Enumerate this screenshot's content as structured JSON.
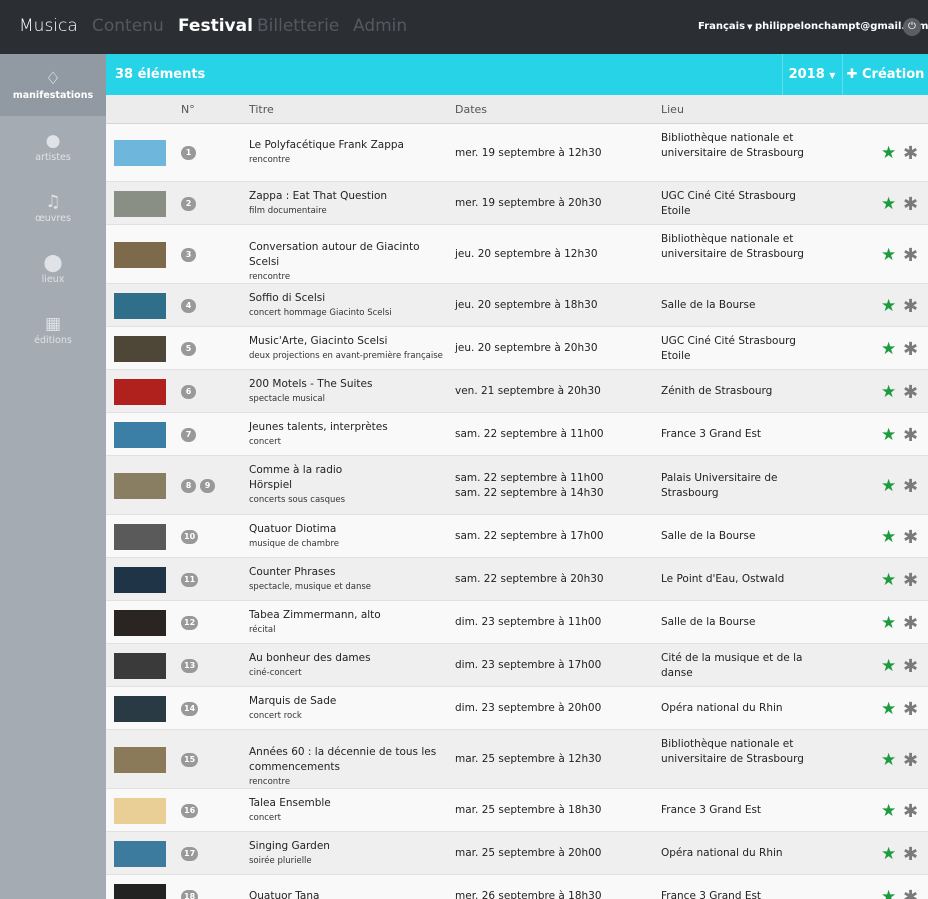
{
  "topbar": {
    "brand": "Musica",
    "nav": [
      "Contenu",
      "Festival",
      "Billetterie",
      "Admin"
    ],
    "language": "Français",
    "user": "philippelonchampt@gmail.com"
  },
  "sidebar": [
    {
      "label": "manifestations",
      "icon": "diamond-icon"
    },
    {
      "label": "artistes",
      "icon": "user-icon"
    },
    {
      "label": "œuvres",
      "icon": "music-icon"
    },
    {
      "label": "lieux",
      "icon": "map-marker-icon"
    },
    {
      "label": "éditions",
      "icon": "calendar-icon"
    }
  ],
  "toolbar": {
    "count": "38 éléments",
    "year": "2018",
    "create": "Création"
  },
  "columns": [
    "N°",
    "Titre",
    "Dates",
    "Lieu"
  ],
  "colors": {
    "accent": "#27d3e6",
    "topbar": "#2b2e33",
    "sidebar": "#a4abb3",
    "star": "#1e9b3f"
  },
  "rows": [
    {
      "nums": [
        "1"
      ],
      "title": "Le Polyfacétique Frank Zappa",
      "sub": "rencontre",
      "dates": [
        "mer. 19 septembre à 12h30"
      ],
      "lieu": "Bibliothèque nationale et universitaire de Strasbourg",
      "thumb": "#6fb6dc"
    },
    {
      "nums": [
        "2"
      ],
      "title": "Zappa : Eat That Question",
      "sub": "film documentaire",
      "dates": [
        "mer. 19 septembre à 20h30"
      ],
      "lieu": "UGC Ciné Cité Strasbourg Etoile",
      "thumb": "#8a8f86"
    },
    {
      "nums": [
        "3"
      ],
      "title": "Conversation autour de Giacinto Scelsi",
      "sub": "rencontre",
      "dates": [
        "jeu. 20 septembre à 12h30"
      ],
      "lieu": "Bibliothèque nationale et universitaire de Strasbourg",
      "thumb": "#7c6a4a"
    },
    {
      "nums": [
        "4"
      ],
      "title": "Soffio di Scelsi",
      "sub": "concert hommage Giacinto Scelsi",
      "dates": [
        "jeu. 20 septembre à 18h30"
      ],
      "lieu": "Salle de la Bourse",
      "thumb": "#2f6f8a"
    },
    {
      "nums": [
        "5"
      ],
      "title": "Music'Arte, Giacinto Scelsi",
      "sub": "deux projections en avant-première française",
      "dates": [
        "jeu. 20 septembre à 20h30"
      ],
      "lieu": "UGC Ciné Cité Strasbourg Etoile",
      "thumb": "#4e4636"
    },
    {
      "nums": [
        "6"
      ],
      "title": "200 Motels - The Suites",
      "sub": "spectacle musical",
      "dates": [
        "ven. 21 septembre à 20h30"
      ],
      "lieu": "Zénith de Strasbourg",
      "thumb": "#b0201c"
    },
    {
      "nums": [
        "7"
      ],
      "title": "Jeunes talents, interprètes",
      "sub": "concert",
      "dates": [
        "sam. 22 septembre à 11h00"
      ],
      "lieu": "France 3 Grand Est",
      "thumb": "#3b7ea6"
    },
    {
      "nums": [
        "8",
        "9"
      ],
      "title": "Comme à la radio\nHörspiel",
      "sub": "concerts sous casques",
      "dates": [
        "sam. 22 septembre à 11h00",
        "sam. 22 septembre à 14h30"
      ],
      "lieu": "Palais Universitaire de Strasbourg",
      "thumb": "#8a7e62"
    },
    {
      "nums": [
        "10"
      ],
      "title": "Quatuor Diotima",
      "sub": "musique de chambre",
      "dates": [
        "sam. 22 septembre à 17h00"
      ],
      "lieu": "Salle de la Bourse",
      "thumb": "#5a5a5a"
    },
    {
      "nums": [
        "11"
      ],
      "title": "Counter Phrases",
      "sub": "spectacle, musique et danse",
      "dates": [
        "sam. 22 septembre à 20h30"
      ],
      "lieu": "Le Point d'Eau, Ostwald",
      "thumb": "#1f3447"
    },
    {
      "nums": [
        "12"
      ],
      "title": "Tabea Zimmermann, alto",
      "sub": "récital",
      "dates": [
        "dim. 23 septembre à 11h00"
      ],
      "lieu": "Salle de la Bourse",
      "thumb": "#2a2522"
    },
    {
      "nums": [
        "13"
      ],
      "title": "Au bonheur des dames",
      "sub": "ciné-concert",
      "dates": [
        "dim. 23 septembre à 17h00"
      ],
      "lieu": "Cité de la musique et de la danse",
      "thumb": "#3a3a3a"
    },
    {
      "nums": [
        "14"
      ],
      "title": "Marquis de Sade",
      "sub": "concert rock",
      "dates": [
        "dim. 23 septembre à 20h00"
      ],
      "lieu": "Opéra national du Rhin",
      "thumb": "#2a3a44"
    },
    {
      "nums": [
        "15"
      ],
      "title": "Années 60 : la décennie de tous les commencements",
      "sub": "rencontre",
      "dates": [
        "mar. 25 septembre à 12h30"
      ],
      "lieu": "Bibliothèque nationale et universitaire de Strasbourg",
      "thumb": "#8b7a5a"
    },
    {
      "nums": [
        "16"
      ],
      "title": "Talea Ensemble",
      "sub": "concert",
      "dates": [
        "mar. 25 septembre à 18h30"
      ],
      "lieu": "France 3 Grand Est",
      "thumb": "#e9cf96"
    },
    {
      "nums": [
        "17"
      ],
      "title": "Singing Garden",
      "sub": "soirée plurielle",
      "dates": [
        "mar. 25 septembre à 20h00"
      ],
      "lieu": "Opéra national du Rhin",
      "thumb": "#3c7a9e"
    },
    {
      "nums": [
        "18"
      ],
      "title": "Quatuor Tana",
      "sub": "",
      "dates": [
        "mer. 26 septembre à 18h30"
      ],
      "lieu": "France 3 Grand Est",
      "thumb": "#222222"
    }
  ]
}
